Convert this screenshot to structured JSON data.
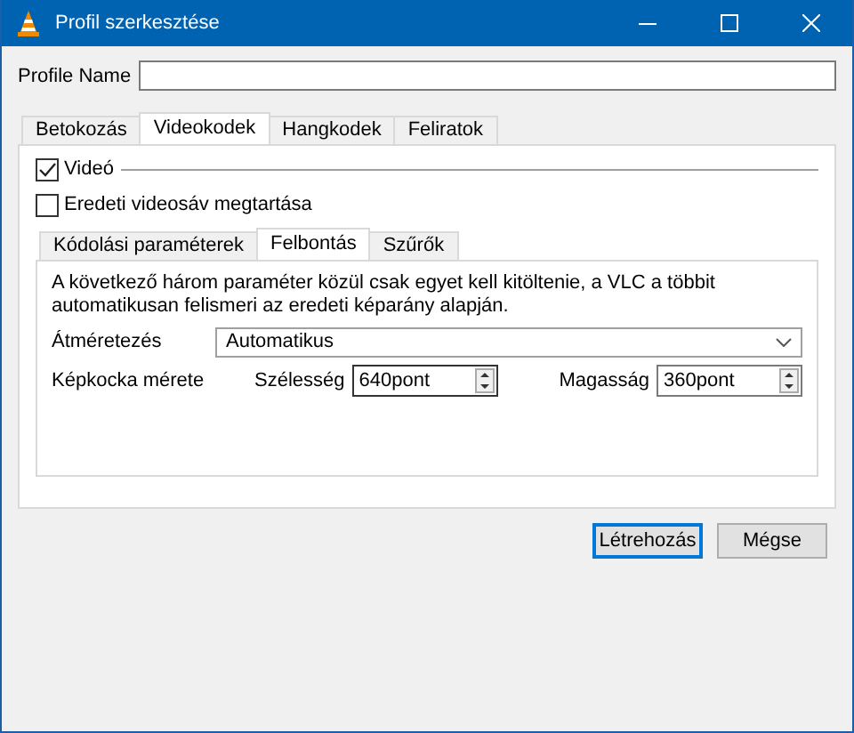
{
  "window": {
    "title": "Profil szerkesztése"
  },
  "profile_name": {
    "label": "Profile Name"
  },
  "tabs": [
    {
      "label": "Betokozás",
      "selected": false
    },
    {
      "label": "Videokodek",
      "selected": true
    },
    {
      "label": "Hangkodek",
      "selected": false
    },
    {
      "label": "Feliratok",
      "selected": false
    }
  ],
  "video": {
    "label": "Videó",
    "checked": true
  },
  "keep_original": {
    "label": "Eredeti videosáv megtartása",
    "checked": false
  },
  "subtabs": [
    {
      "label": "Kódolási paraméterek",
      "selected": false
    },
    {
      "label": "Felbontás",
      "selected": true
    },
    {
      "label": "Szűrők",
      "selected": false
    }
  ],
  "hint": "A következő három paraméter közül csak egyet kell kitöltenie, a VLC a többit automatikusan felismeri az eredeti képarány alapján.",
  "resize": {
    "label": "Átméretezés",
    "value": "Automatikus"
  },
  "frame_size": {
    "label": "Képkocka mérete",
    "width_label": "Szélesség",
    "width": "640pont",
    "height_label": "Magasság",
    "height": "360pont"
  },
  "buttons": [
    {
      "label": "Létrehozás",
      "default": true
    },
    {
      "label": "Mégse",
      "default": false
    }
  ]
}
